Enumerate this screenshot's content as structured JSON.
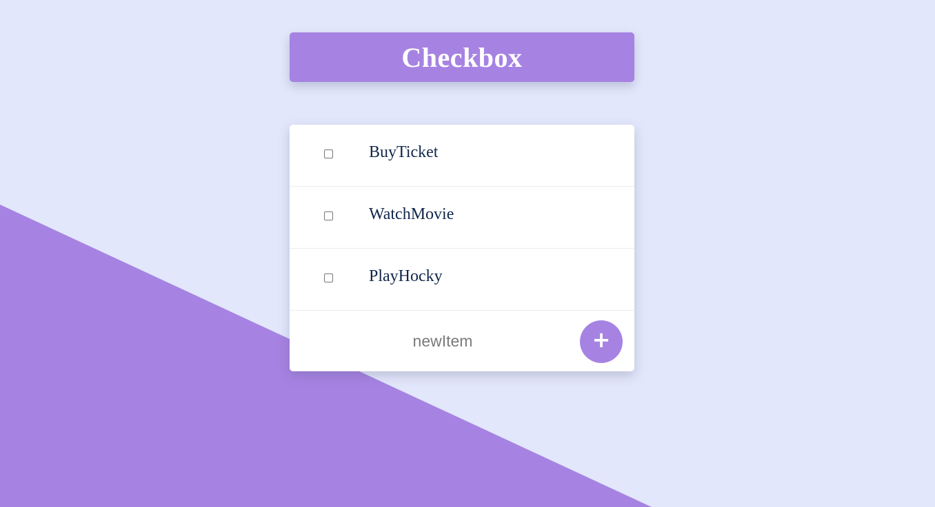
{
  "page": {
    "colors": {
      "background": "#e2e7fb",
      "accent": "#a683e2",
      "card": "#ffffff",
      "item_text": "#11264a"
    }
  },
  "header": {
    "title": "Checkbox"
  },
  "todo": {
    "items": [
      {
        "label": "BuyTicket",
        "checked": false
      },
      {
        "label": "WatchMovie",
        "checked": false
      },
      {
        "label": "PlayHocky",
        "checked": false
      }
    ],
    "new_item": {
      "value": "",
      "placeholder": "newItem"
    },
    "add_button": {
      "label": "+",
      "icon": "plus-icon"
    }
  }
}
